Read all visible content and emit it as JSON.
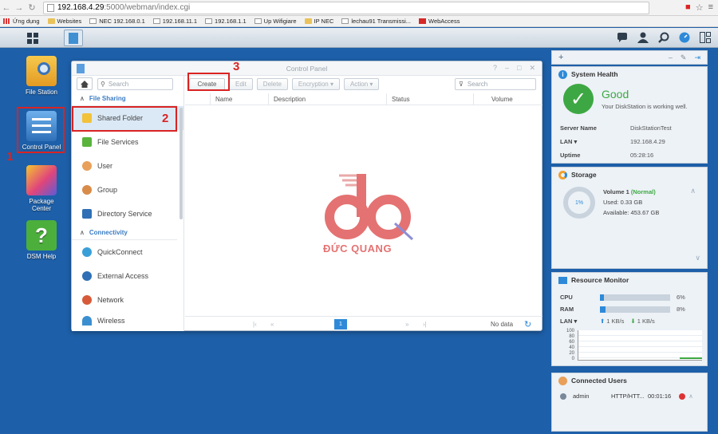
{
  "browser": {
    "url_host": "192.168.4.29",
    "url_path": ":5000/webman/index.cgi",
    "bookmarks": [
      "Ứng dụng",
      "Websites",
      "NEC 192.168.0.1",
      "192.168.11.1",
      "192.168.1.1",
      "Up Wifigiare",
      "IP NEC",
      "lechau91 Transmissi...",
      "WebAccess"
    ]
  },
  "desktop": {
    "icons": [
      {
        "label": "File Station"
      },
      {
        "label": "Control Panel"
      },
      {
        "label": "Package Center"
      },
      {
        "label": "DSM Help"
      }
    ]
  },
  "steps": {
    "one": "1",
    "two": "2",
    "three": "3"
  },
  "control_panel": {
    "title": "Control Panel",
    "search_placeholder": "Search",
    "section_file_sharing": "File Sharing",
    "section_connectivity": "Connectivity",
    "items": [
      "Shared Folder",
      "File Services",
      "User",
      "Group",
      "Directory Service",
      "QuickConnect",
      "External Access",
      "Network",
      "Wireless"
    ],
    "toolbar": {
      "create": "Create",
      "edit": "Edit",
      "delete": "Delete",
      "encryption": "Encryption ▾",
      "action": "Action ▾",
      "search_placeholder": "Search"
    },
    "columns": [
      "Name",
      "Description",
      "Status",
      "Volume"
    ],
    "pager": {
      "current": "1",
      "status": "No data"
    }
  },
  "watermark": {
    "text": "ĐỨC QUANG"
  },
  "widgets": {
    "system_health": {
      "title": "System Health",
      "status": "Good",
      "message": "Your DiskStation is working well.",
      "rows": [
        {
          "k": "Server Name",
          "v": "DiskStationTest"
        },
        {
          "k": "LAN ▾",
          "v": "192.168.4.29"
        },
        {
          "k": "Uptime",
          "v": "05:28:16"
        }
      ]
    },
    "storage": {
      "title": "Storage",
      "percent": "1%",
      "volume": "Volume 1",
      "state": "(Normal)",
      "used": "Used: 0.33 GB",
      "available": "Available: 453.67 GB"
    },
    "resource_monitor": {
      "title": "Resource Monitor",
      "cpu_label": "CPU",
      "cpu_value": "6%",
      "cpu_fraction": 0.06,
      "ram_label": "RAM",
      "ram_value": "8%",
      "ram_fraction": 0.08,
      "lan_label": "LAN ▾",
      "lan_up": "1 KB/s",
      "lan_down": "1 KB/s",
      "y_ticks": [
        "100",
        "80",
        "60",
        "40",
        "20",
        "0"
      ]
    },
    "connected_users": {
      "title": "Connected Users",
      "user": "admin",
      "protocol": "HTTP/HTT...",
      "time": "00:01:16"
    }
  }
}
